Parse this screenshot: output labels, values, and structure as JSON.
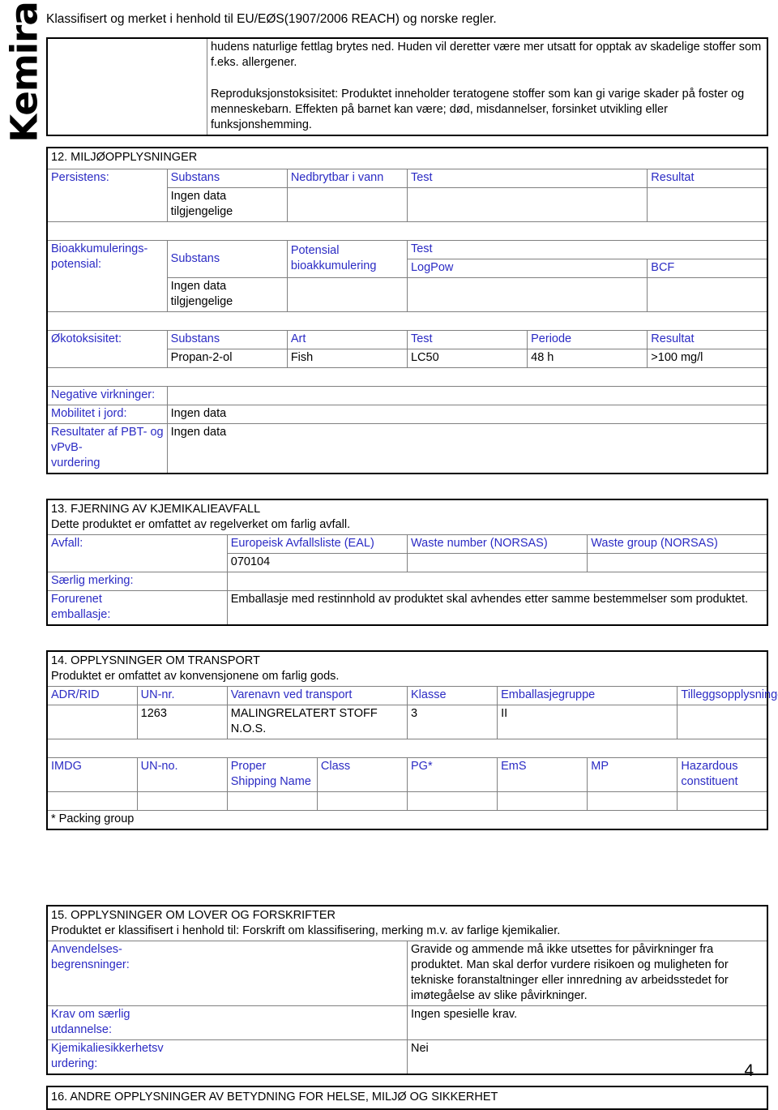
{
  "logo": {
    "text": "Kemira"
  },
  "header": {
    "classification_line": "Klassifisert og merket i henhold til EU/EØS(1907/2006 REACH) og norske regler."
  },
  "continued_box": {
    "paragraph_1": "hudens naturlige fettlag brytes ned. Huden vil deretter være mer utsatt for opptak av skadelige stoffer som f.eks. allergener.",
    "paragraph_2": "Reproduksjonstoksisitet: Produktet inneholder teratogene stoffer som kan gi varige skader på foster og menneskebarn. Effekten på barnet kan være; død, misdannelser, forsinket utvikling eller funksjonshemming."
  },
  "section12": {
    "heading": "12. MILJØOPPLYSNINGER",
    "persistens": {
      "label": "Persistens:",
      "columns": [
        "Substans",
        "Nedbrytbar i vann",
        "Test",
        "Resultat"
      ],
      "rows": [
        [
          "Ingen data tilgjengelige",
          "",
          "",
          ""
        ]
      ]
    },
    "bioakkumulering": {
      "label_line1": "Bioakkumulerings-",
      "label_line2": "potensial:",
      "col_substans": "Substans",
      "col_potensial_line1": "Potensial",
      "col_potensial_line2": "bioakkumulering",
      "col_test": "Test",
      "col_logpow": "LogPow",
      "col_bcf": "BCF",
      "rows": [
        [
          "Ingen data tilgjengelige",
          "",
          "",
          ""
        ]
      ]
    },
    "okotoksisitet": {
      "label": "Økotoksisitet:",
      "columns": [
        "Substans",
        "Art",
        "Test",
        "Periode",
        "Resultat"
      ],
      "rows": [
        [
          "Propan-2-ol",
          "Fish",
          "LC50",
          "48 h",
          ">100 mg/l"
        ]
      ]
    },
    "negative_virkninger": {
      "label": "Negative virkninger:",
      "value": ""
    },
    "mobilitet": {
      "label": "Mobilitet i jord:",
      "value": "Ingen data"
    },
    "pbt": {
      "label_line1": "Resultater af PBT- og vPvB-",
      "label_line2": "vurdering",
      "value": "Ingen data"
    }
  },
  "section13": {
    "heading": "13. FJERNING AV KJEMIKALIEAVFALL",
    "subheading": "Dette produktet er omfattet av regelverket om farlig avfall.",
    "avfall": {
      "label": "Avfall:",
      "columns": [
        "Europeisk Avfallsliste (EAL)",
        "Waste number (NORSAS)",
        "Waste group (NORSAS)"
      ],
      "rows": [
        [
          "070104",
          "",
          ""
        ]
      ]
    },
    "saerlig_merking": {
      "label": "Særlig merking:",
      "value": ""
    },
    "forurenet_emballasje": {
      "label_line1": "Forurenet",
      "label_line2": "emballasje:",
      "value": "Emballasje med restinnhold av produktet skal avhendes etter samme bestemmelser som produktet."
    }
  },
  "section14": {
    "heading": "14. OPPLYSNINGER OM TRANSPORT",
    "subheading": "Produktet er omfattet av konvensjonene om farlig gods.",
    "adr": {
      "columns": [
        "ADR/RID",
        "UN-nr.",
        "Varenavn ved transport",
        "Klasse",
        "Emballasjegruppe",
        "Tilleggsopplysninger"
      ],
      "rows": [
        [
          "",
          "1263",
          "MALINGRELATERT STOFF N.O.S.",
          "3",
          "II",
          ""
        ]
      ]
    },
    "imdg": {
      "columns": [
        "IMDG",
        "UN-no.",
        "Proper Shipping Name",
        "Class",
        "PG*",
        "EmS",
        "MP",
        "Hazardous constituent"
      ],
      "rows": [
        [
          "",
          "",
          "",
          "",
          "",
          "",
          "",
          ""
        ]
      ]
    },
    "footnote": "* Packing group"
  },
  "section15": {
    "heading": "15. OPPLYSNINGER OM LOVER OG FORSKRIFTER",
    "subheading": "Produktet er klassifisert i henhold til: Forskrift om klassifisering, merking m.v. av farlige kjemikalier.",
    "anvendelse": {
      "label_line1": "Anvendelses-",
      "label_line2": "begrensninger:",
      "value": "Gravide og ammende må ikke utsettes for påvirkninger fra produktet. Man skal derfor vurdere risikoen og muligheten for tekniske foranstaltninger eller innredning av arbeidsstedet for imøtegåelse av slike påvirkninger."
    },
    "krav": {
      "label_line1": "Krav om særlig",
      "label_line2": "utdannelse:",
      "value": "Ingen spesielle krav."
    },
    "ksv": {
      "label_line1": "Kjemikaliesikkerhetsv",
      "label_line2": "urdering:",
      "value": "Nei"
    }
  },
  "section16": {
    "heading": "16. ANDRE OPPLYSNINGER AV BETYDNING FOR HELSE, MILJØ OG SIKKERHET"
  },
  "footer": {
    "page_number": "4"
  },
  "colors": {
    "label_blue": "#2b2bc4",
    "text_black": "#000000",
    "border_gray": "#808080",
    "border_black": "#000000"
  }
}
